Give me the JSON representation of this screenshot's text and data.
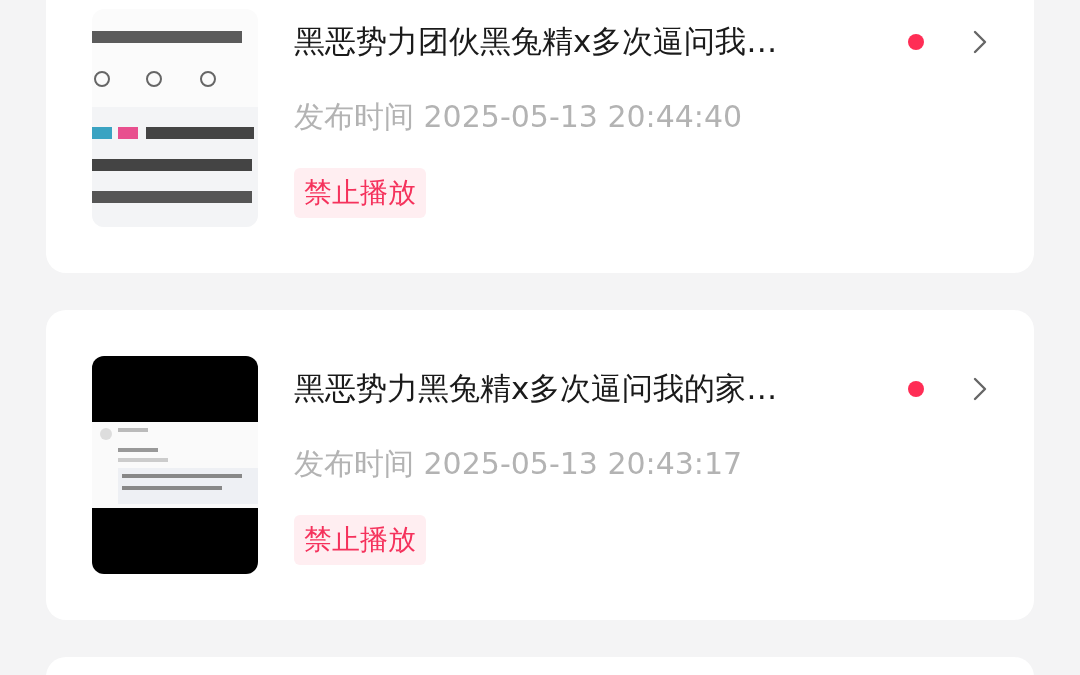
{
  "videos": [
    {
      "title": "黑恶势力团伙黑兔精x多次逼问我…",
      "unread": true,
      "publish_time": "发布时间 2025-05-13 20:44:40",
      "status": "禁止播放"
    },
    {
      "title": "黑恶势力黑兔精x多次逼问我的家…",
      "unread": true,
      "publish_time": "发布时间 2025-05-13 20:43:17",
      "status": "禁止播放"
    }
  ]
}
